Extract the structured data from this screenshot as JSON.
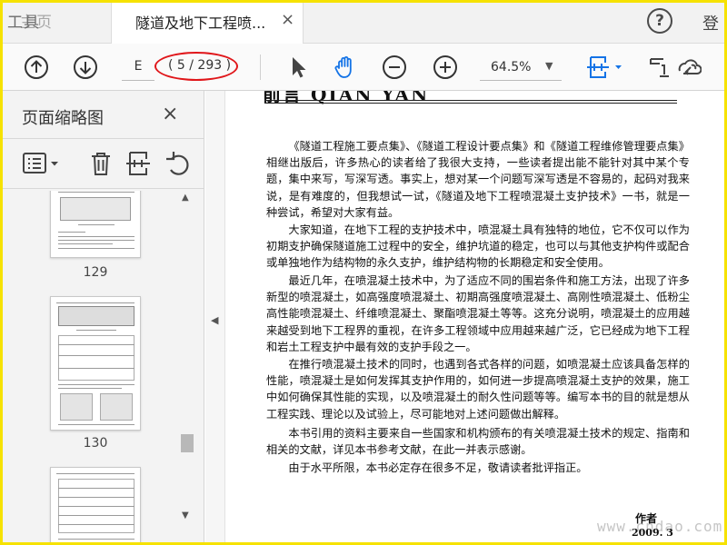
{
  "tabs": {
    "tools_label": "工具",
    "home_label": "主页",
    "document_title": "隧道及地下工程喷...",
    "close_glyph": "×"
  },
  "header_right": {
    "help_glyph": "?",
    "login_label": "登"
  },
  "toolbar": {
    "page_input_value": "E",
    "page_count": "( 5 / 293 )",
    "zoom_value": "64.5%",
    "icons": [
      "arrow-up-icon",
      "arrow-down-icon",
      "select-pointer-icon",
      "hand-icon",
      "zoom-out-icon",
      "zoom-in-icon",
      "page-fit-icon",
      "sign-icon",
      "share-link-icon"
    ],
    "annotation_color": "#e0161a"
  },
  "sidebar": {
    "title": "页面缩略图",
    "close_glyph": "×",
    "thumbnails": [
      {
        "page_label": "129"
      },
      {
        "page_label": "130"
      },
      {
        "page_label": ""
      }
    ]
  },
  "document": {
    "header_fragment": "前言 QIAN YAN",
    "paragraphs": [
      "《隧道工程施工要点集》、《隧道工程设计要点集》和《隧道工程维修管理要点集》相继出版后，许多热心的读者给了我很大支持，一些读者提出能不能针对其中某个专题，集中来写，写深写透。事实上，想对某一个问题写深写透是不容易的，起码对我来说，是有难度的，但我想试一试，《隧道及地下工程喷混凝土支护技术》一书，就是一种尝试，希望对大家有益。",
      "大家知道，在地下工程的支护技术中，喷混凝土具有独特的地位，它不仅可以作为初期支护确保隧道施工过程中的安全，维护坑道的稳定，也可以与其他支护构件或配合或单独地作为结构物的永久支护，维护结构物的长期稳定和安全使用。",
      "最近几年，在喷混凝土技术中，为了适应不同的围岩条件和施工方法，出现了许多新型的喷混凝土，如高强度喷混凝土、初期高强度喷混凝土、高刚性喷混凝土、低粉尘高性能喷混凝土、纤维喷混凝土、聚酯喷混凝土等等。这充分说明，喷混凝土的应用越来越受到地下工程界的重视，在许多工程领域中应用越来越广泛，它已经成为地下工程和岩土工程支护中最有效的支护手段之一。",
      "在推行喷混凝土技术的同时，也遇到各式各样的问题，如喷混凝土应该具备怎样的性能，喷混凝土是如何发挥其支护作用的，如何进一步提高喷混凝土支护的效果，施工中如何确保其性能的实现，以及喷混凝土的耐久性问题等等。编写本书的目的就是想从工程实践、理论以及试验上，尽可能地对上述问题做出解释。",
      "本书引用的资料主要来自一些国家和机构颁布的有关喷混凝土技术的规定、指南和相关的文献，详见本书参考文献，在此一并表示感谢。",
      "由于水平所限，本书必定存在很多不足，敬请读者批评指正。"
    ],
    "author": "作者",
    "date": "2009. 3",
    "watermark": "www.cndao.com"
  }
}
